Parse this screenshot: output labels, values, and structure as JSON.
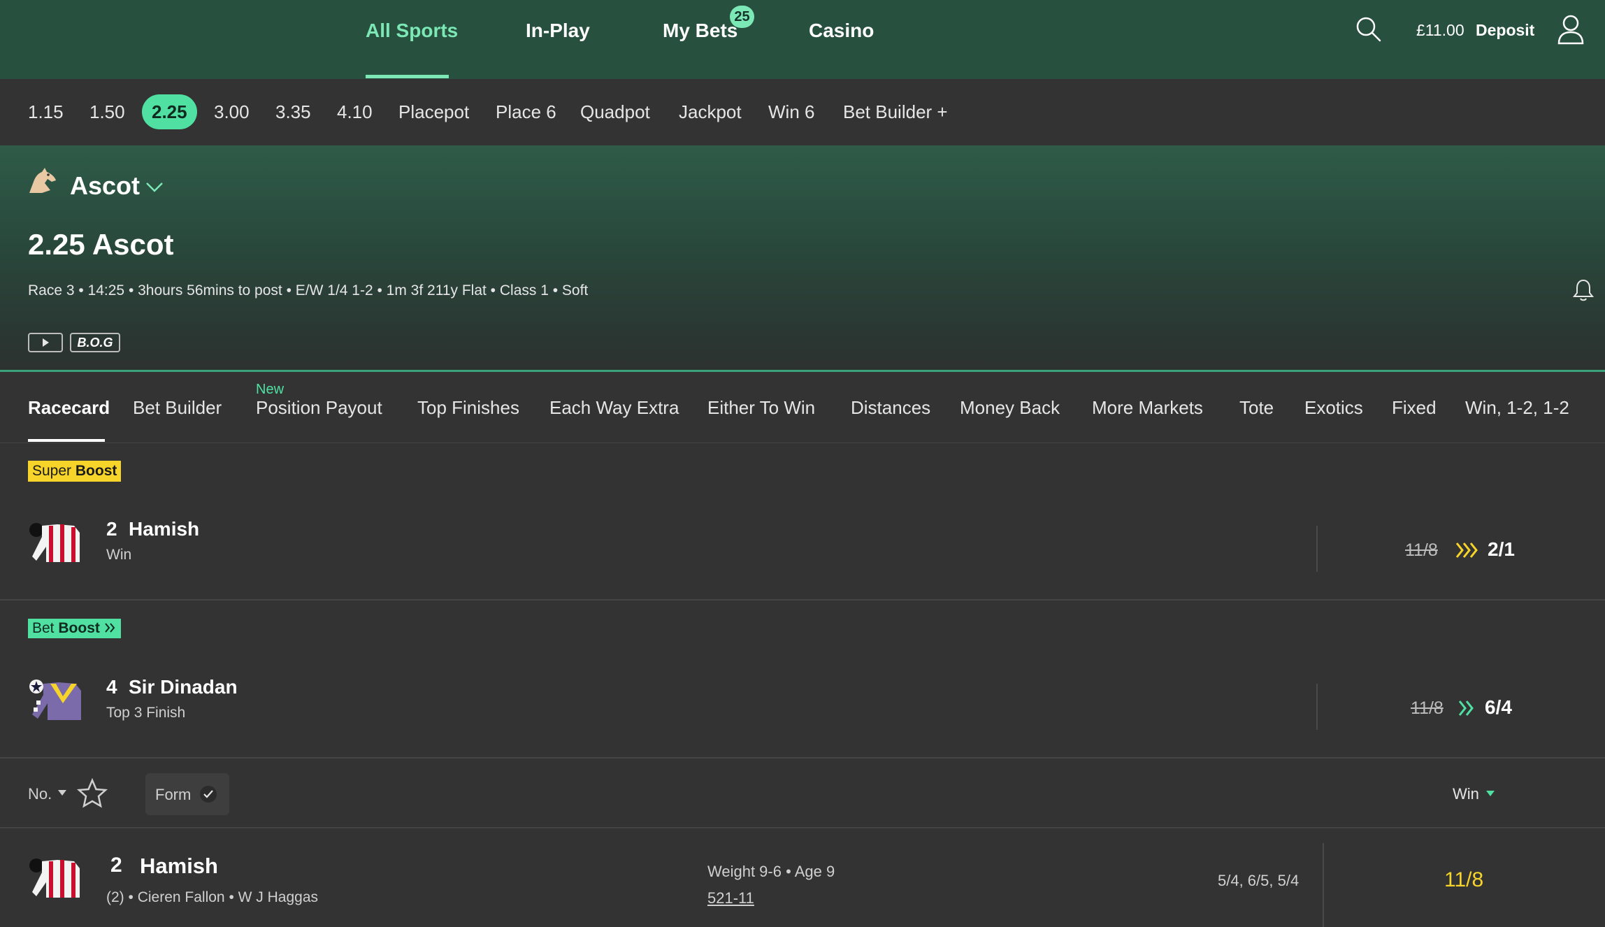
{
  "nav": {
    "items": [
      "All Sports",
      "In-Play",
      "My Bets",
      "Casino"
    ],
    "my_bets_badge": "25",
    "balance": "£11.00",
    "deposit_label": "Deposit"
  },
  "times": {
    "items": [
      "1.15",
      "1.50",
      "2.25",
      "3.00",
      "3.35",
      "4.10",
      "Placepot",
      "Place 6",
      "Quadpot",
      "Jackpot",
      "Win 6",
      "Bet Builder +"
    ],
    "active": "2.25"
  },
  "race": {
    "course": "Ascot",
    "title": "2.25 Ascot",
    "meta": "Race 3 • 14:25 • 3hours 56mins to post • E/W 1/4 1-2 • 1m 3f 211y Flat • Class 1 • Soft",
    "bog_label": "B.O.G"
  },
  "tabs": {
    "items": [
      "Racecard",
      "Bet Builder",
      "Position Payout",
      "Top Finishes",
      "Each Way Extra",
      "Either To Win",
      "Distances",
      "Money Back",
      "More Markets",
      "Tote",
      "Exotics",
      "Fixed",
      "Win, 1-2, 1-2"
    ],
    "new_label": "New"
  },
  "super_boost": {
    "label_a": "Super",
    "label_b": "Boost",
    "number": "2",
    "name": "Hamish",
    "market": "Win",
    "old_odds": "11/8",
    "new_odds": "2/1"
  },
  "bet_boost": {
    "label_a": "Bet",
    "label_b": "Boost",
    "number": "4",
    "name": "Sir Dinadan",
    "market": "Top 3 Finish",
    "old_odds": "11/8",
    "new_odds": "6/4"
  },
  "filter": {
    "sort_label": "No.",
    "form_label": "Form",
    "market_label": "Win"
  },
  "runner": {
    "number": "2",
    "name": "Hamish",
    "draw": "(2)",
    "jockey": "Cieren Fallon",
    "trainer": "W J Haggas",
    "weight": "Weight 9-6",
    "age": "Age 9",
    "form": "521-11",
    "prev_prices": "5/4, 6/5, 5/4",
    "price": "11/8"
  },
  "colors": {
    "nav_bg": "#27503e",
    "accent": "#4fe0a2",
    "super_boost": "#f7d42a",
    "price": "#f7d42a"
  }
}
